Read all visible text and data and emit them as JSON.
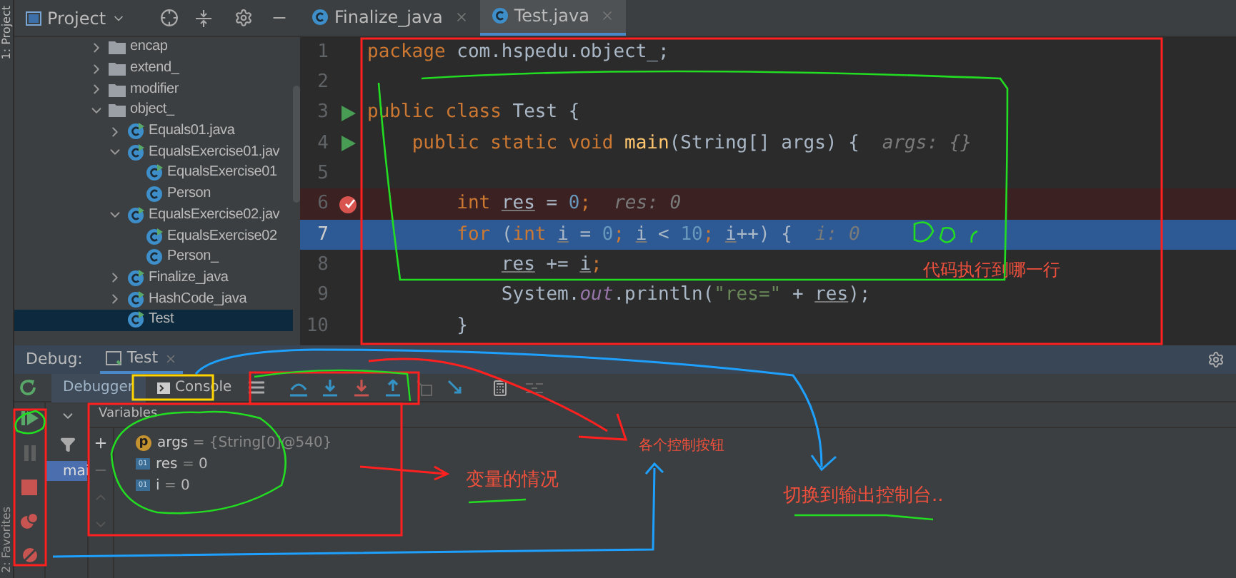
{
  "side_strip": {
    "top_label": "1: Project",
    "bottom_label": "2: Favorites"
  },
  "project_panel": {
    "title": "Project",
    "tree": [
      {
        "name": "encap",
        "kind": "folder",
        "expanded": false,
        "selected": false
      },
      {
        "name": "extend_",
        "kind": "folder",
        "expanded": false,
        "selected": false
      },
      {
        "name": "modifier",
        "kind": "folder",
        "expanded": false,
        "selected": false
      },
      {
        "name": "object_",
        "kind": "folder",
        "expanded": true,
        "selected": false,
        "children": [
          {
            "name": "Equals01.java",
            "kind": "runnable",
            "expanded": false,
            "selected": false
          },
          {
            "name": "EqualsExercise01.jav",
            "kind": "runnable",
            "expanded": true,
            "selected": false,
            "children": [
              {
                "name": "EqualsExercise01",
                "kind": "runnable",
                "selected": false
              },
              {
                "name": "Person",
                "kind": "class",
                "selected": false
              }
            ]
          },
          {
            "name": "EqualsExercise02.jav",
            "kind": "runnable",
            "expanded": true,
            "selected": false,
            "children": [
              {
                "name": "EqualsExercise02",
                "kind": "runnable",
                "selected": false
              },
              {
                "name": "Person_",
                "kind": "class",
                "selected": false
              }
            ]
          },
          {
            "name": "Finalize_java",
            "kind": "runnable",
            "expanded": false,
            "selected": false
          },
          {
            "name": "HashCode_java",
            "kind": "runnable",
            "expanded": false,
            "selected": false
          },
          {
            "name": "Test",
            "kind": "runnable",
            "selected": true
          }
        ]
      }
    ]
  },
  "editor": {
    "tabs": [
      {
        "label": "Finalize_java",
        "selected": false
      },
      {
        "label": "Test.java",
        "selected": true
      }
    ],
    "lines": [
      {
        "number": "1",
        "run_marker": false,
        "breakpoint": false,
        "execution_point": false,
        "segments": [
          {
            "kind": "keyword",
            "text": "package"
          },
          {
            "kind": "plain",
            "text": " com.hspedu.object_;"
          }
        ]
      },
      {
        "number": "2",
        "run_marker": false,
        "breakpoint": false,
        "execution_point": false
      },
      {
        "number": "3",
        "run_marker": true,
        "breakpoint": false,
        "execution_point": false,
        "segments": [
          {
            "kind": "keyword",
            "text": "public class "
          },
          {
            "kind": "plain",
            "text": "Test {"
          }
        ]
      },
      {
        "number": "4",
        "run_marker": true,
        "breakpoint": false,
        "execution_point": false,
        "segments": [
          {
            "kind": "keyword",
            "text": "    public static void "
          },
          {
            "kind": "method",
            "text": "main"
          },
          {
            "kind": "plain",
            "text": "(String[] args) {"
          },
          {
            "kind": "hint",
            "text": "args: {}"
          }
        ]
      },
      {
        "number": "5",
        "run_marker": false,
        "breakpoint": false,
        "execution_point": false
      },
      {
        "number": "6",
        "run_marker": false,
        "breakpoint": true,
        "execution_point": false,
        "segments": [
          {
            "kind": "keyword",
            "text": "        int "
          },
          {
            "kind": "var",
            "text": "res"
          },
          {
            "kind": "plain",
            "text": " = "
          },
          {
            "kind": "number",
            "text": "0"
          },
          {
            "kind": "keyword",
            "text": ";"
          },
          {
            "kind": "hint",
            "text": "res: 0"
          }
        ]
      },
      {
        "number": "7",
        "run_marker": false,
        "breakpoint": false,
        "execution_point": true,
        "segments": [
          {
            "kind": "keyword",
            "text": "        for"
          },
          {
            "kind": "plain",
            "text": " ("
          },
          {
            "kind": "keyword",
            "text": "int "
          },
          {
            "kind": "var",
            "text": "i"
          },
          {
            "kind": "plain",
            "text": " = "
          },
          {
            "kind": "number",
            "text": "0"
          },
          {
            "kind": "keyword",
            "text": "; "
          },
          {
            "kind": "var",
            "text": "i"
          },
          {
            "kind": "plain",
            "text": " < "
          },
          {
            "kind": "number",
            "text": "10"
          },
          {
            "kind": "keyword",
            "text": "; "
          },
          {
            "kind": "var",
            "text": "i"
          },
          {
            "kind": "plain",
            "text": "++) {"
          },
          {
            "kind": "hint",
            "text": "i: 0"
          }
        ]
      },
      {
        "number": "8",
        "run_marker": false,
        "breakpoint": false,
        "execution_point": false,
        "segments": [
          {
            "kind": "var",
            "text": "            res"
          },
          {
            "kind": "plain",
            "text": " += "
          },
          {
            "kind": "var",
            "text": "i"
          },
          {
            "kind": "keyword",
            "text": ";"
          }
        ]
      },
      {
        "number": "9",
        "run_marker": false,
        "breakpoint": false,
        "execution_point": false,
        "segments": [
          {
            "kind": "plain",
            "text": "            System."
          },
          {
            "kind": "field",
            "text": "out"
          },
          {
            "kind": "plain",
            "text": ".println("
          },
          {
            "kind": "string",
            "text": "\"res=\""
          },
          {
            "kind": "plain",
            "text": " + "
          },
          {
            "kind": "var",
            "text": "res"
          },
          {
            "kind": "plain",
            "text": ");"
          }
        ]
      },
      {
        "number": "10",
        "run_marker": false,
        "breakpoint": false,
        "execution_point": false,
        "segments": [
          {
            "kind": "plain",
            "text": "        }"
          }
        ]
      }
    ]
  },
  "debug": {
    "label": "Debug:",
    "session_tab": "Test",
    "tabs": [
      {
        "label": "Debugger",
        "selected": true
      },
      {
        "label": "Console",
        "selected": false
      }
    ],
    "frames": [
      {
        "label": "mai",
        "selected": true
      }
    ],
    "variables_title": "Variables",
    "variables": [
      {
        "kind": "param",
        "badge": "p",
        "name": "args",
        "operator": "=",
        "value": "{String[0]@540}"
      },
      {
        "kind": "local",
        "badge": "01",
        "name": "res",
        "operator": "=",
        "value": "0"
      },
      {
        "kind": "local",
        "badge": "01",
        "name": "i",
        "operator": "=",
        "value": "0"
      }
    ]
  },
  "annotations": [
    {
      "text": "代码执行到哪一行"
    },
    {
      "text": "各个控制按钮"
    },
    {
      "text": "变量的情况"
    },
    {
      "text": "切换到输出控制台.."
    }
  ]
}
